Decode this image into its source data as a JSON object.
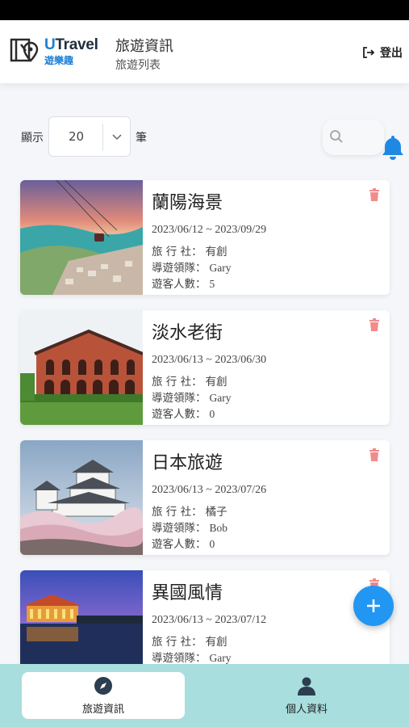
{
  "app": {
    "logo_text_u": "U",
    "logo_text_rest": "Travel",
    "logo_sub": "遊樂趣",
    "title": "旅遊資訊",
    "subtitle": "旅遊列表",
    "logout_label": "登出"
  },
  "toolbar": {
    "show_label": "顯示",
    "page_size": "20",
    "unit_label": "筆"
  },
  "labels": {
    "agency": "旅 行 社：",
    "guide": "導遊領隊：",
    "visitors": "遊客人數："
  },
  "tours": [
    {
      "title": "蘭陽海景",
      "date": "2023/06/12 ~ 2023/09/29",
      "agency": "有創",
      "guide": "Gary",
      "visitors": "5"
    },
    {
      "title": "淡水老街",
      "date": "2023/06/13 ~ 2023/06/30",
      "agency": "有創",
      "guide": "Gary",
      "visitors": "0"
    },
    {
      "title": "日本旅遊",
      "date": "2023/06/13 ~ 2023/07/26",
      "agency": "橘子",
      "guide": "Bob",
      "visitors": "0"
    },
    {
      "title": "異國風情",
      "date": "2023/06/13 ~ 2023/07/12",
      "agency": "有創",
      "guide": "Gary",
      "visitors": ""
    }
  ],
  "nav": {
    "tour_info": "旅遊資訊",
    "profile": "個人資料"
  },
  "colors": {
    "accent": "#2196f3",
    "nav_bg": "#a8dede",
    "trash": "#f28b8b"
  }
}
